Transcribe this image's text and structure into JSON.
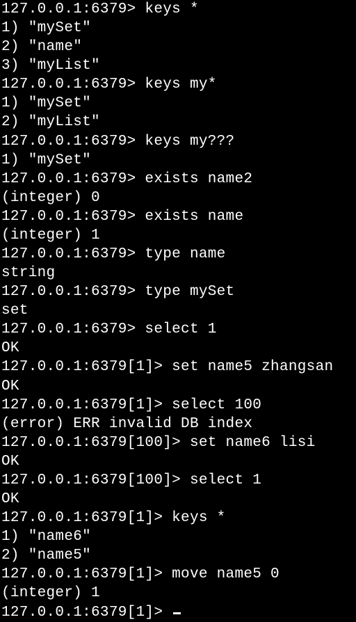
{
  "terminal": {
    "lines": [
      "127.0.0.1:6379> keys *",
      "1) \"mySet\"",
      "2) \"name\"",
      "3) \"myList\"",
      "127.0.0.1:6379> keys my*",
      "1) \"mySet\"",
      "2) \"myList\"",
      "127.0.0.1:6379> keys my???",
      "1) \"mySet\"",
      "127.0.0.1:6379> exists name2",
      "(integer) 0",
      "127.0.0.1:6379> exists name",
      "(integer) 1",
      "127.0.0.1:6379> type name",
      "string",
      "127.0.0.1:6379> type mySet",
      "set",
      "127.0.0.1:6379> select 1",
      "OK",
      "127.0.0.1:6379[1]> set name5 zhangsan",
      "OK",
      "127.0.0.1:6379[1]> select 100",
      "(error) ERR invalid DB index",
      "127.0.0.1:6379[100]> set name6 lisi",
      "OK",
      "127.0.0.1:6379[100]> select 1",
      "OK",
      "127.0.0.1:6379[1]> keys *",
      "1) \"name6\"",
      "2) \"name5\"",
      "127.0.0.1:6379[1]> move name5 0",
      "(integer) 1",
      "127.0.0.1:6379[1]> "
    ]
  }
}
